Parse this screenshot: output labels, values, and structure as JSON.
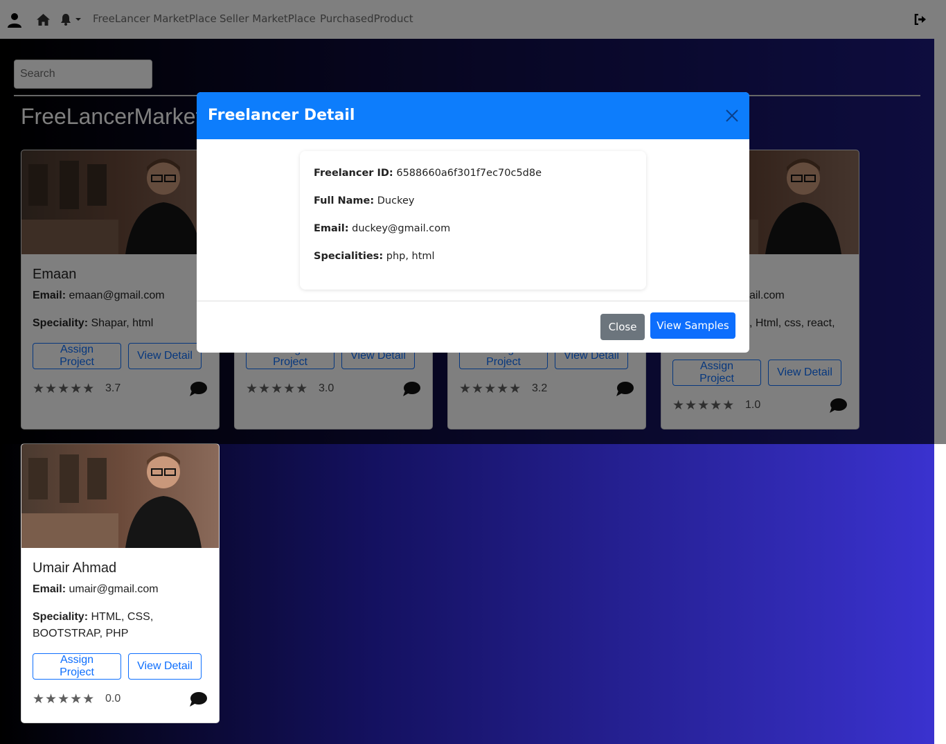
{
  "navbar": {
    "links": [
      "FreeLancer MarketPlace",
      "Seller MarketPlace",
      "PurchasedProduct"
    ]
  },
  "search": {
    "placeholder": "Search"
  },
  "page_title": "FreeLancerMarketPlace",
  "cards": [
    {
      "name": "Emaan",
      "email_label": "Email:",
      "email": "emaan@gmail.com",
      "speciality_label": "Speciality:",
      "speciality": "Shapar, html",
      "assign_label": "Assign Project",
      "detail_label": "View Detail",
      "rating": "3.7",
      "stars": "★★★★★"
    },
    {
      "assign_label": "Assign Project",
      "detail_label": "View Detail",
      "rating": "3.0",
      "stars": "★★★★★"
    },
    {
      "assign_label": "Assign Project",
      "detail_label": "View Detail",
      "rating": "3.2",
      "stars": "★★★★★"
    },
    {
      "email_fragment": "ail.com",
      "speciality_fragment": ", Html, css, react,",
      "assign_label": "Assign Project",
      "detail_label": "View Detail",
      "rating": "1.0",
      "stars": "★★★★★"
    },
    {
      "name": "Umair Ahmad",
      "email_label": "Email:",
      "email": "umair@gmail.com",
      "speciality_label": "Speciality:",
      "speciality": "HTML, CSS, BOOTSTRAP, PHP",
      "assign_label": "Assign Project",
      "detail_label": "View Detail",
      "rating": "0.0",
      "stars": "★★★★★"
    }
  ],
  "modal": {
    "title": "Freelancer Detail",
    "fields": [
      {
        "label": "Freelancer ID:",
        "value": "6588660a6f301f7ec70c5d8e"
      },
      {
        "label": "Full Name:",
        "value": "Duckey"
      },
      {
        "label": "Email:",
        "value": "duckey@gmail.com"
      },
      {
        "label": "Specialities:",
        "value": "php, html"
      }
    ],
    "close_label": "Close",
    "samples_label": "View Samples"
  },
  "colors": {
    "accent": "#0d6efd",
    "modal_header": "#0d7dfc",
    "close_button": "#6c757d"
  }
}
